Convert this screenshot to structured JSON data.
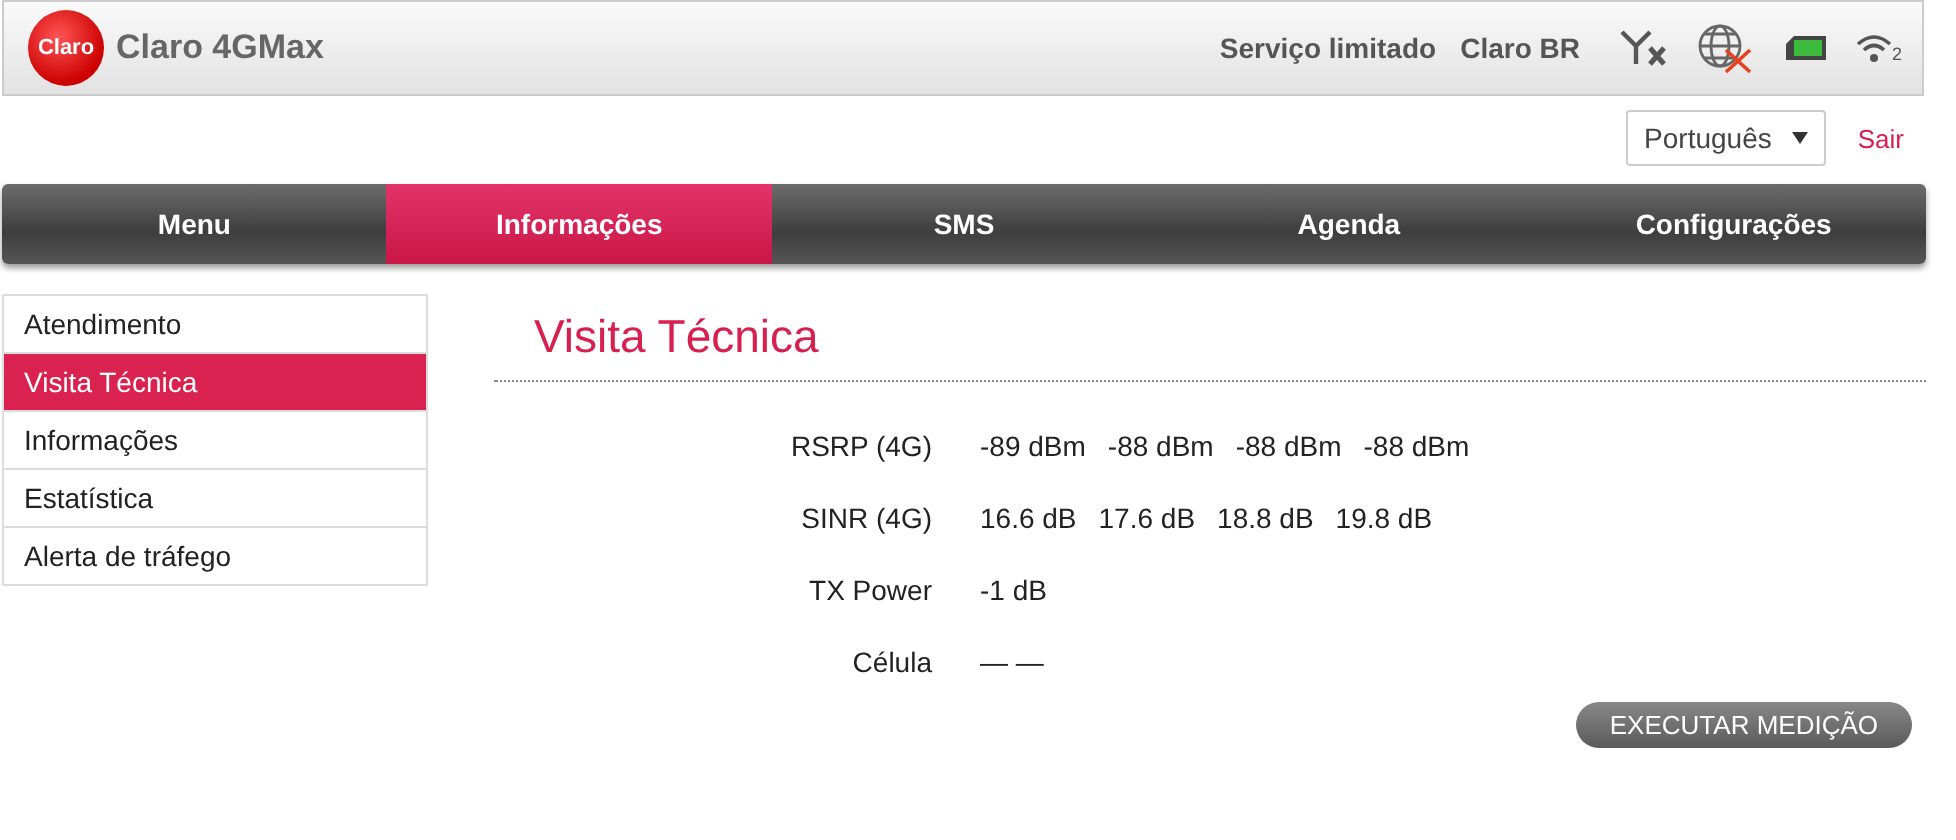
{
  "header": {
    "logo_text": "Claro",
    "title": "Claro 4GMax",
    "service_status": "Serviço limitado",
    "operator": "Claro BR",
    "wifi_clients": "2"
  },
  "language": {
    "value": "Português"
  },
  "logout": "Sair",
  "tabs": [
    {
      "label": "Menu",
      "selected": false
    },
    {
      "label": "Informações",
      "selected": true
    },
    {
      "label": "SMS",
      "selected": false
    },
    {
      "label": "Agenda",
      "selected": false
    },
    {
      "label": "Configurações",
      "selected": false
    }
  ],
  "sidebar": {
    "items": [
      {
        "label": "Atendimento",
        "selected": false
      },
      {
        "label": "Visita Técnica",
        "selected": true
      },
      {
        "label": "Informações",
        "selected": false
      },
      {
        "label": "Estatística",
        "selected": false
      },
      {
        "label": "Alerta de tráfego",
        "selected": false
      }
    ]
  },
  "content": {
    "title": "Visita Técnica",
    "rows": [
      {
        "label": "RSRP (4G)",
        "values": [
          "-89 dBm",
          "-88 dBm",
          "-88 dBm",
          "-88 dBm"
        ]
      },
      {
        "label": "SINR (4G)",
        "values": [
          "16.6 dB",
          "17.6 dB",
          "18.8 dB",
          "19.8 dB"
        ]
      },
      {
        "label": "TX Power",
        "values": [
          "-1 dB"
        ]
      },
      {
        "label": "Célula",
        "values": [
          "— —"
        ]
      }
    ],
    "button": "EXECUTAR MEDIÇÃO"
  }
}
